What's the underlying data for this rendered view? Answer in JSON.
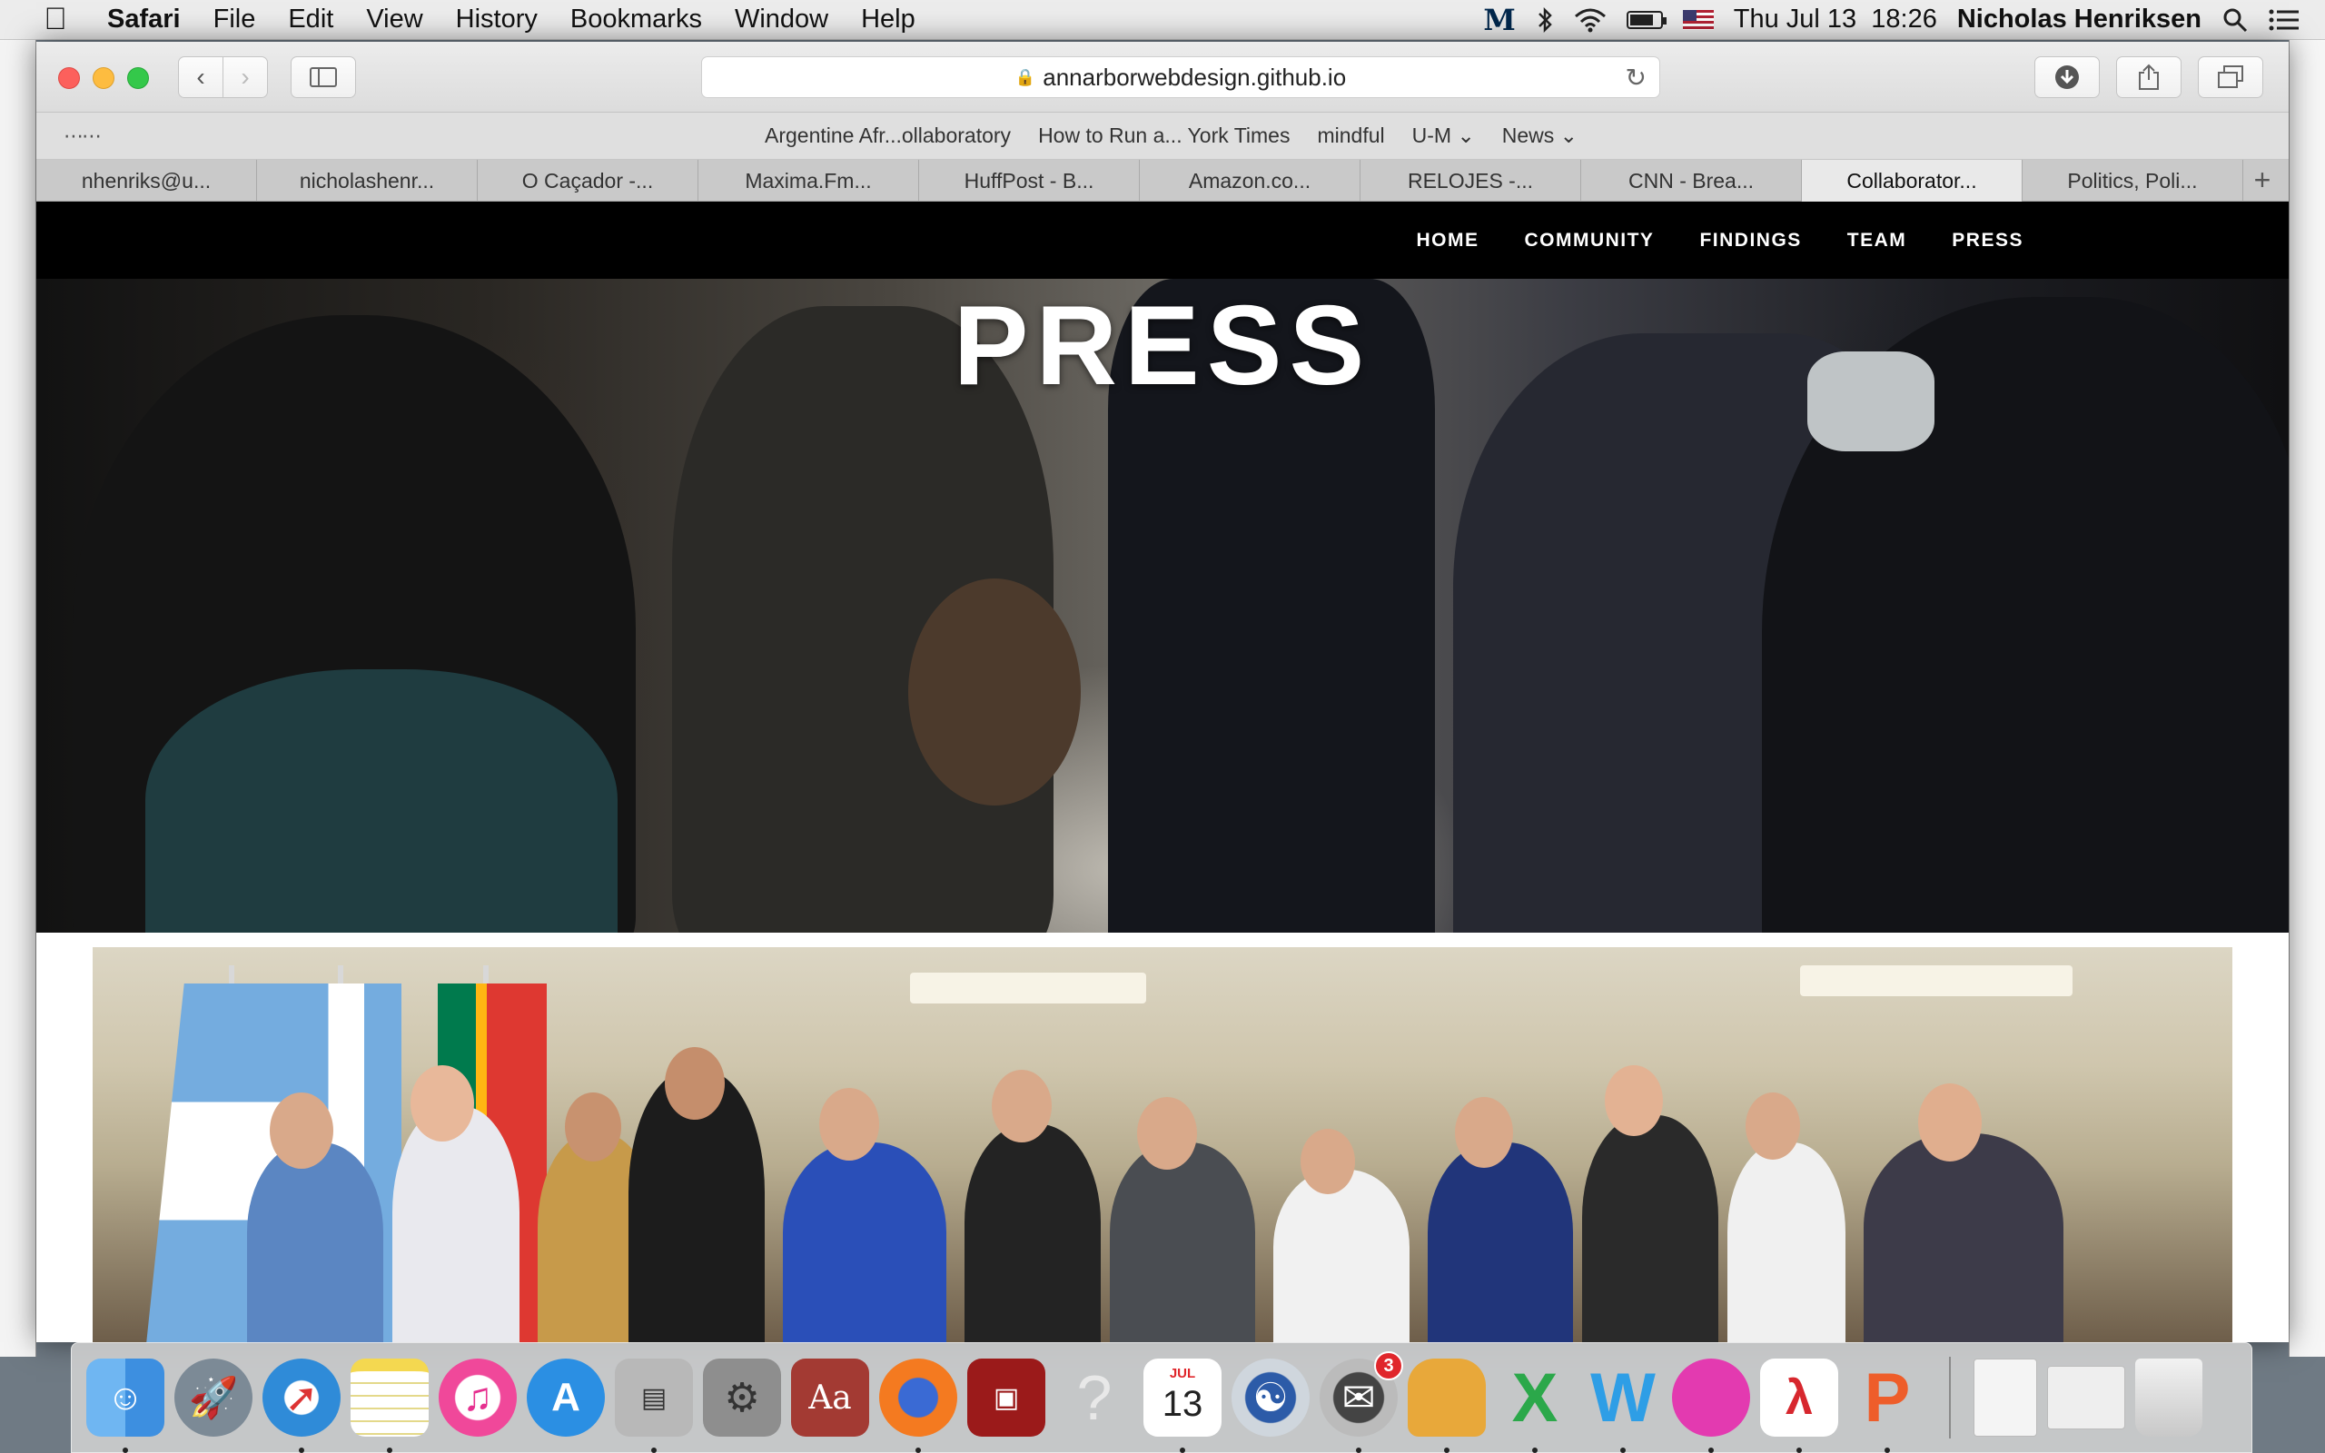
{
  "menubar": {
    "apple_icon": "apple-icon",
    "app_name": "Safari",
    "items": [
      "File",
      "Edit",
      "View",
      "History",
      "Bookmarks",
      "Window",
      "Help"
    ],
    "status": {
      "um_logo": "M",
      "datetime": "Thu Jul 13  18:26",
      "user": "Nicholas Henriksen"
    }
  },
  "safari": {
    "address": "annarborwebdesign.github.io",
    "favorites": [
      "Argentine Afr...ollaboratory",
      "How to Run a... York Times",
      "mindful",
      "U-M ⌄",
      "News ⌄"
    ],
    "tabs": [
      {
        "label": "nhenriks@u...",
        "active": false
      },
      {
        "label": "nicholashenr...",
        "active": false
      },
      {
        "label": "O Caçador -...",
        "active": false
      },
      {
        "label": "Maxima.Fm...",
        "active": false
      },
      {
        "label": "HuffPost - B...",
        "active": false
      },
      {
        "label": "Amazon.co...",
        "active": false
      },
      {
        "label": "RELOJES -...",
        "active": false
      },
      {
        "label": "CNN - Brea...",
        "active": false
      },
      {
        "label": "Collaborator...",
        "active": true
      },
      {
        "label": "Politics, Poli...",
        "active": false
      }
    ]
  },
  "site": {
    "nav": [
      "HOME",
      "COMMUNITY",
      "FINDINGS",
      "TEAM",
      "PRESS"
    ],
    "hero_title": "PRESS"
  },
  "dock": {
    "calendar_month": "JUL",
    "calendar_day": "13",
    "mail_badge": "3"
  }
}
